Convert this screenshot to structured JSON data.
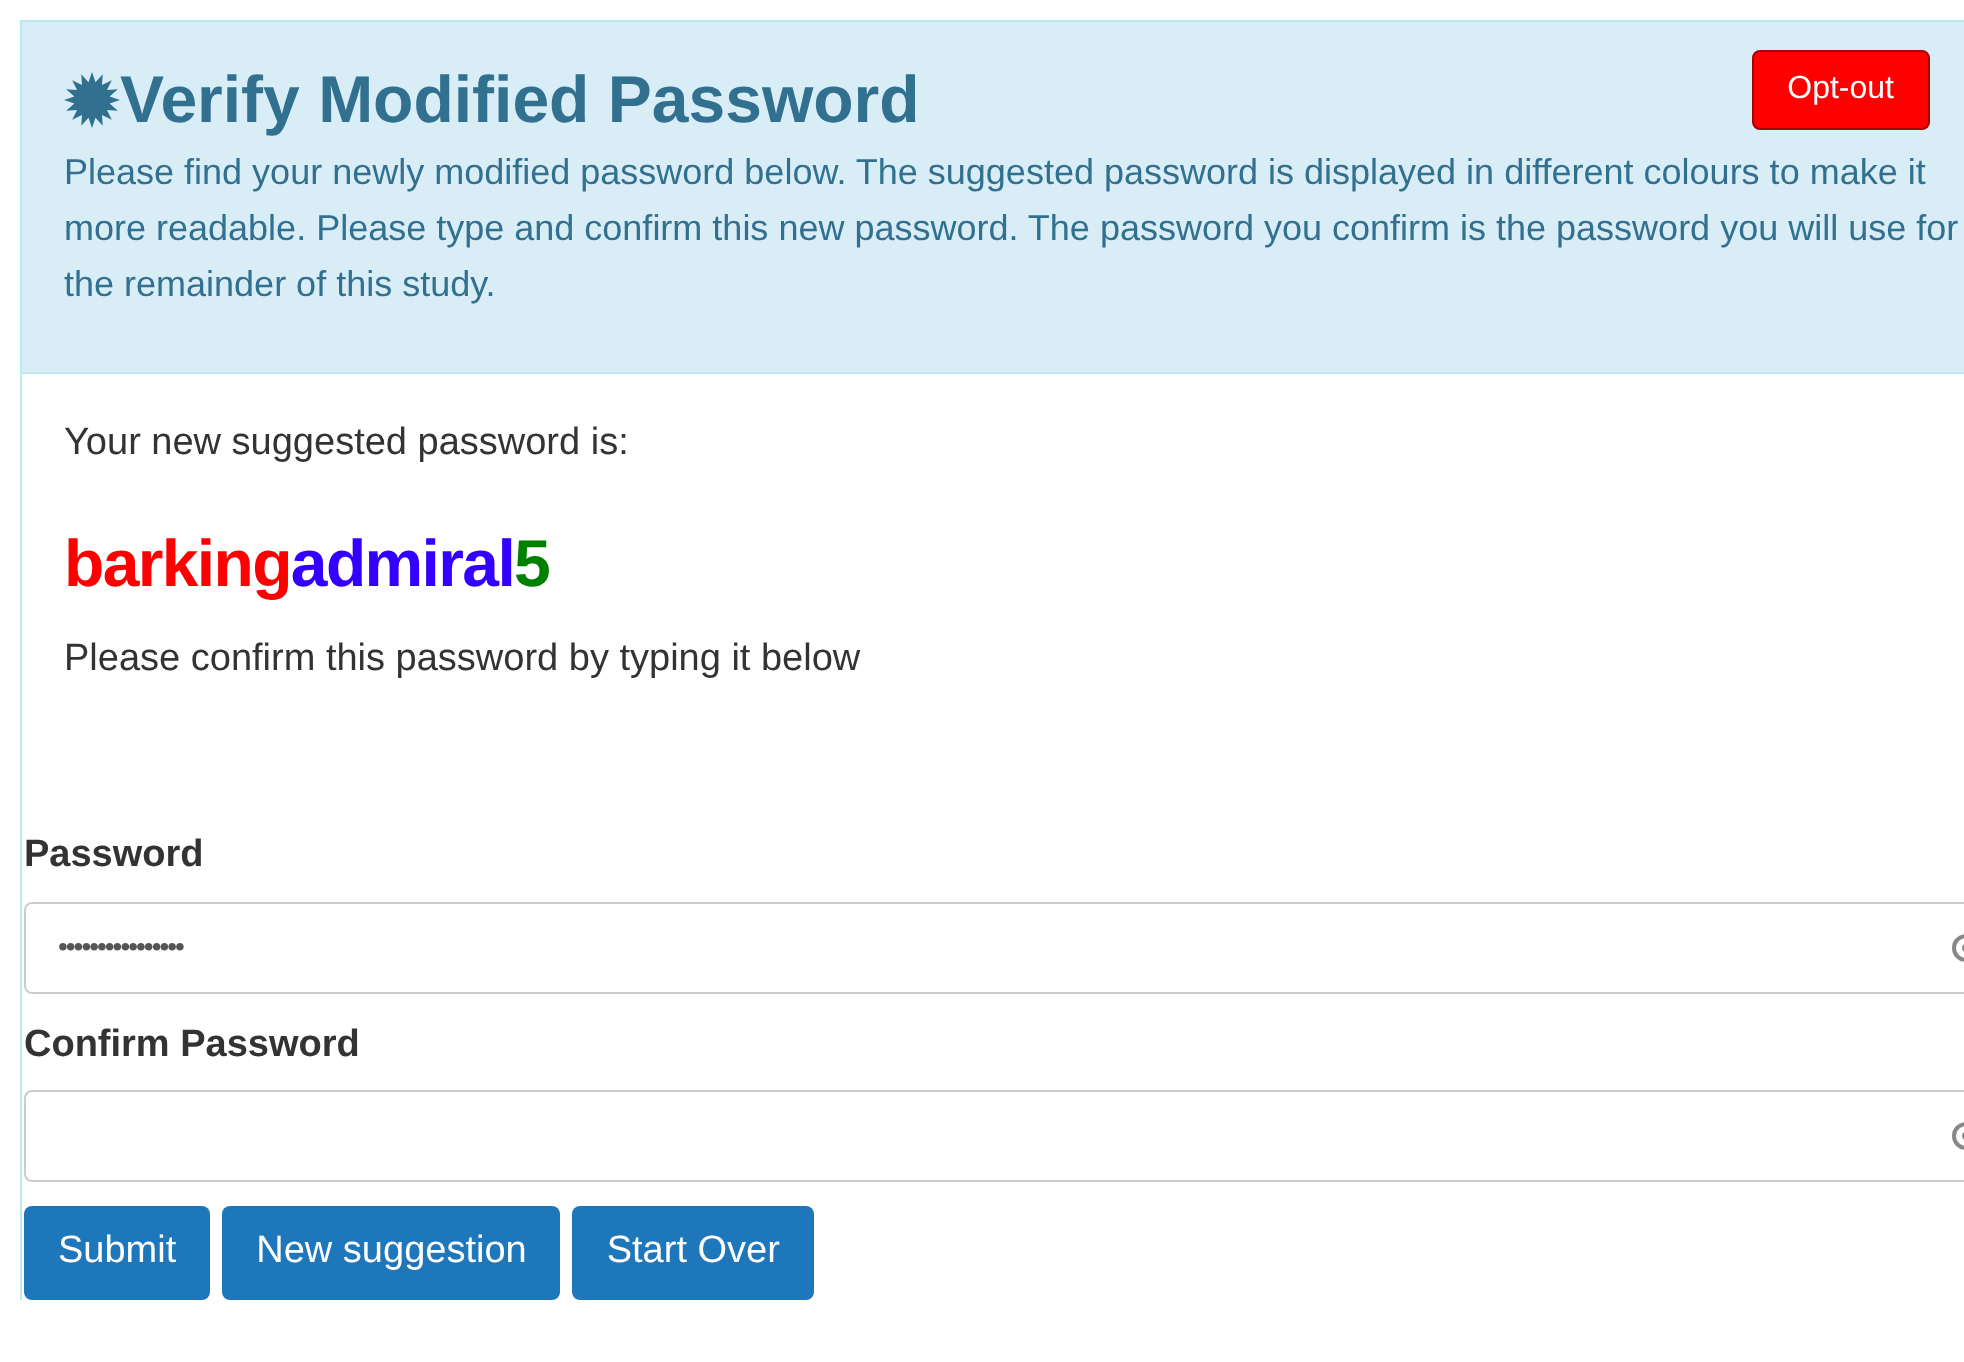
{
  "header": {
    "title": "Verify Modified Password",
    "opt_out": "Opt-out",
    "description": "Please find your newly modified password below. The suggested password is displayed in different colours to make it more readable. Please type and confirm this new password. The password you confirm is the password you will use for the remainder of this study."
  },
  "suggestion": {
    "intro": "Your new suggested password is:",
    "parts": [
      {
        "text": "barking",
        "color": "#ff0000"
      },
      {
        "text": "admiral",
        "color": "#3300ff"
      },
      {
        "text": "5",
        "color": "#008000"
      }
    ],
    "instruction": "Please confirm this password by typing it below"
  },
  "fields": [
    {
      "label": "Password",
      "value": "••••••••••••••••"
    },
    {
      "label": "Confirm Password"
    }
  ],
  "buttons": [
    "Submit",
    "New suggestion",
    "Start Over"
  ]
}
